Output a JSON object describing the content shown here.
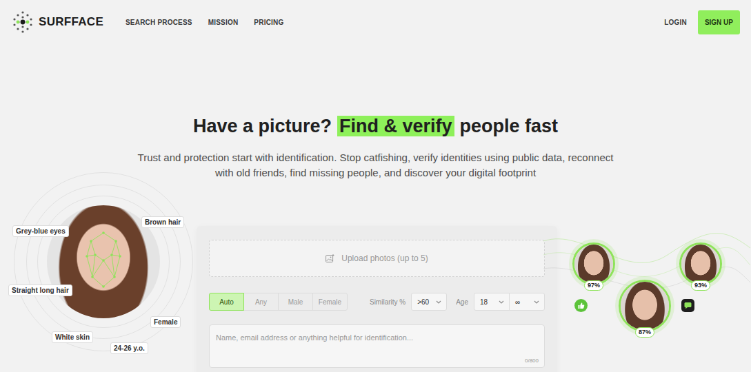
{
  "brand": {
    "name": "SURFFACE"
  },
  "nav": [
    {
      "label": "SEARCH PROCESS"
    },
    {
      "label": "MISSION"
    },
    {
      "label": "PRICING"
    }
  ],
  "auth": {
    "login": "LOGIN",
    "signup": "SIGN UP"
  },
  "hero": {
    "title": [
      "Have a picture?",
      "Find & verify",
      "people fast"
    ],
    "subtitle": "Trust and protection start with identification. Stop catfishing, verify identities using public data, reconnect with old friends, find missing people, and discover your digital footprint"
  },
  "face": {
    "labels": [
      {
        "text": "Grey-blue eyes"
      },
      {
        "text": "Brown hair"
      },
      {
        "text": "Straight long hair"
      },
      {
        "text": "Female"
      },
      {
        "text": "White skin"
      },
      {
        "text": "24-26 y.o."
      }
    ]
  },
  "search": {
    "upload": "Upload photos (up to 5)",
    "genders": [
      {
        "label": "Auto",
        "selected": true
      },
      {
        "label": "Any",
        "selected": false
      },
      {
        "label": "Male",
        "selected": false
      },
      {
        "label": "Female",
        "selected": false
      }
    ],
    "similarity": {
      "label": "Similarity %",
      "value": ">60"
    },
    "age": {
      "label": "Age",
      "from": "18",
      "to": "∞"
    },
    "details": {
      "placeholder": "Name, email address or anything helpful for identification...",
      "counter": "0/800"
    }
  },
  "matches": [
    {
      "percent": "97%"
    },
    {
      "percent": "93%"
    },
    {
      "percent": "87%"
    }
  ]
}
